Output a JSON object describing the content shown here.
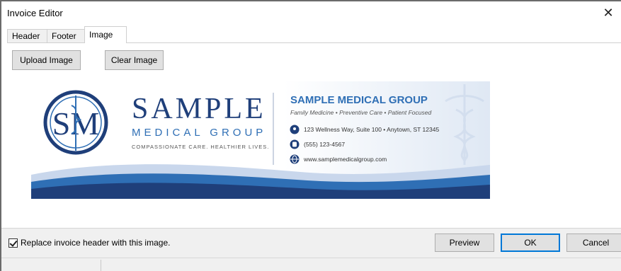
{
  "window": {
    "title": "Invoice Editor",
    "close_glyph": "✕"
  },
  "tabs": [
    {
      "label": "Header",
      "active": false
    },
    {
      "label": "Footer",
      "active": false
    },
    {
      "label": "Image",
      "active": true
    }
  ],
  "toolbar": {
    "upload_label": "Upload Image",
    "clear_label": "Clear Image"
  },
  "banner": {
    "monogram": "SM",
    "brand_word": "SAMPLE",
    "brand_sub": "MEDICAL GROUP",
    "tagline": "COMPASSIONATE CARE. HEALTHIER LIVES.",
    "heading": "SAMPLE MEDICAL GROUP",
    "services": "Family Medicine  •  Preventive Care  •  Patient Focused",
    "address": "123 Wellness Way, Suite 100 • Anytown, ST 12345",
    "phone": "(555) 123-4567",
    "website": "www.samplemedicalgroup.com",
    "colors": {
      "navy": "#1f3f7a",
      "blue": "#2f6fb5",
      "light": "#c9d7ec"
    }
  },
  "footer": {
    "checkbox_label": "Replace invoice header with this image.",
    "checkbox_checked": true,
    "preview_label": "Preview",
    "ok_label": "OK",
    "cancel_label": "Cancel"
  }
}
